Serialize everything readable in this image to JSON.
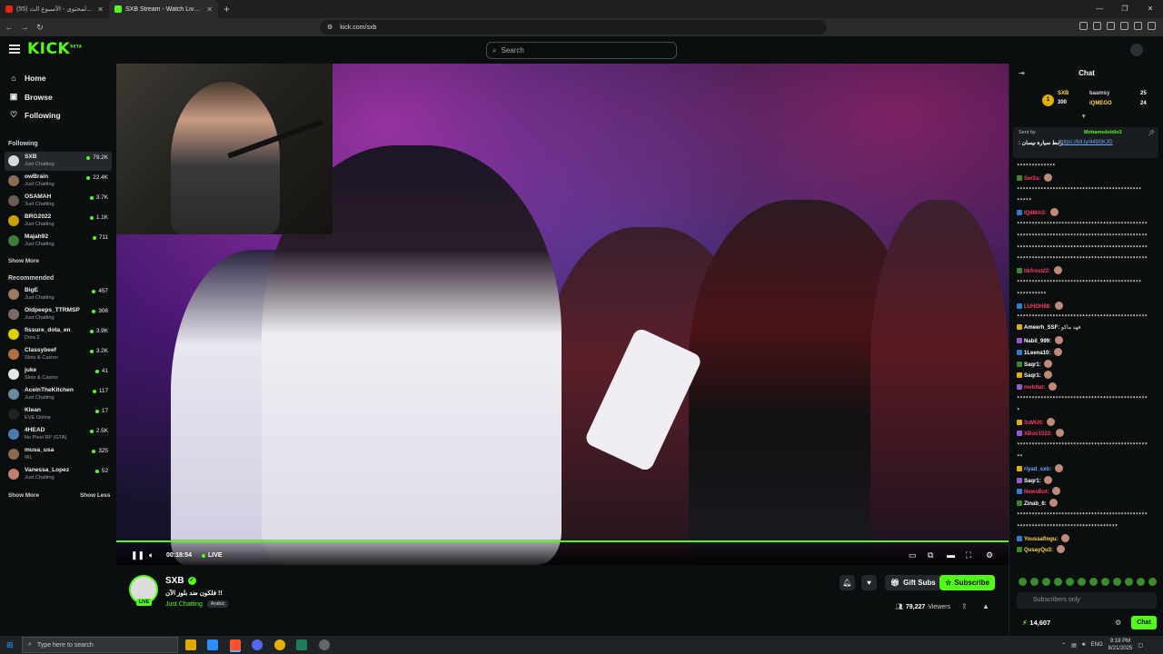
{
  "browser": {
    "tabs": [
      {
        "title": "(55) دوري صناع المحتوى - الأسبوع الث...",
        "favicon_color": "#e62117",
        "active": false
      },
      {
        "title": "SXB Stream - Watch Live on Kick",
        "favicon_color": "#53fc18",
        "active": true
      }
    ],
    "url": "kick.com/sxb"
  },
  "header": {
    "logo": "KICK",
    "logo_sup": "BETA",
    "search_placeholder": "Search"
  },
  "sidebar": {
    "nav": [
      {
        "label": "Home",
        "icon": "home-icon"
      },
      {
        "label": "Browse",
        "icon": "browse-icon"
      },
      {
        "label": "Following",
        "icon": "heart-icon"
      }
    ],
    "following_title": "Following",
    "following": [
      {
        "name": "SXB",
        "category": "Just Chatting",
        "viewers": "79.2K",
        "avatar_color": "#d8d8d8"
      },
      {
        "name": "owBrain",
        "category": "Just Chatting",
        "viewers": "22.4K",
        "avatar_color": "#8a6b55"
      },
      {
        "name": "OSAMAH",
        "category": "Just Chatting",
        "viewers": "3.7K",
        "avatar_color": "#6a5a52"
      },
      {
        "name": "BRG2022",
        "category": "Just Chatting",
        "viewers": "1.1K",
        "avatar_color": "#c9a000"
      },
      {
        "name": "Majah92",
        "category": "Just Chatting",
        "viewers": "711",
        "avatar_color": "#3e7a3a"
      }
    ],
    "show_more": "Show More",
    "recommended_title": "Recommended",
    "recommended": [
      {
        "name": "BigE",
        "category": "Just Chatting",
        "viewers": "457",
        "avatar_color": "#9a7a5a"
      },
      {
        "name": "Oldpeeps_TTRMSP",
        "category": "Just Chatting",
        "viewers": "306",
        "avatar_color": "#7a6a6a"
      },
      {
        "name": "fissure_dota_en",
        "category": "Dota 2",
        "viewers": "3.9K",
        "avatar_color": "#e0d000"
      },
      {
        "name": "Classybeef",
        "category": "Slots & Casino",
        "viewers": "3.2K",
        "avatar_color": "#b07040"
      },
      {
        "name": "juke",
        "category": "Slots & Casino",
        "viewers": "41",
        "avatar_color": "#e8e8e8"
      },
      {
        "name": "AceInTheKitchen",
        "category": "Just Chatting",
        "viewers": "117",
        "avatar_color": "#6a8aa0"
      },
      {
        "name": "Klean",
        "category": "EVE Online",
        "viewers": "17",
        "avatar_color": "#222222"
      },
      {
        "name": "4HEAD",
        "category": "No Pixel RP (GTA)",
        "viewers": "2.5K",
        "avatar_color": "#4a7ab0"
      },
      {
        "name": "musa_usa",
        "category": "IRL",
        "viewers": "325",
        "avatar_color": "#8a6a4a"
      },
      {
        "name": "Vanessa_Lopez",
        "category": "Just Chatting",
        "viewers": "52",
        "avatar_color": "#c08070"
      }
    ],
    "show_less": "Show Less"
  },
  "player": {
    "time": "00:18:54",
    "live_label": "LIVE",
    "progress": 1.0
  },
  "channel": {
    "name": "SXB",
    "title": "!! فلكون ضد بلوز الآن",
    "category": "Just Chatting",
    "tag": "Arabic",
    "live_badge": "LIVE",
    "gift_label": "Gift Subs",
    "subscribe_label": "Subscribe",
    "viewers_count": "79,227",
    "viewers_label": "Viewers"
  },
  "chat": {
    "title": "Chat",
    "leaderboard": {
      "top_name": "SXB",
      "top_count": "300",
      "second_name": "baamsy",
      "second_count": "25",
      "third_name": "iQMEGO",
      "third_count": "24"
    },
    "pinned": {
      "sent_by": "Sent by",
      "author": "Mohamedeldin3",
      "text": "رابط سيارة نيسان :",
      "link": "https://bit.ly/449SKJG"
    },
    "messages": [
      {
        "user": "",
        "color": "#ffffff",
        "text": "٭٭٭٭٭٭٭٭٭٭٭٭٭"
      },
      {
        "user": "Ser2a:",
        "color": "#ff3b5c",
        "text": ""
      },
      {
        "user": "",
        "color": "#ffffff",
        "text": "٭٭٭٭٭٭٭٭٭٭٭٭٭٭٭٭٭٭٭٭٭٭٭٭٭٭٭٭٭٭٭٭٭٭٭٭٭٭٭٭٭٭"
      },
      {
        "user": "",
        "color": "#ffffff",
        "text": "٭٭٭٭٭"
      },
      {
        "user": "IQ8MAS:",
        "color": "#ff3b5c",
        "text": ""
      },
      {
        "user": "",
        "color": "#ffffff",
        "text": "٭٭٭٭٭٭٭٭٭٭٭٭٭٭٭٭٭٭٭٭٭٭٭٭٭٭٭٭٭٭٭٭٭٭٭٭٭٭٭٭٭٭٭٭"
      },
      {
        "user": "",
        "color": "#ffffff",
        "text": "٭٭٭٭٭٭٭٭٭٭٭٭٭٭٭٭٭٭٭٭٭٭٭٭٭٭٭٭٭٭٭٭٭٭٭٭٭٭٭٭٭٭٭٭"
      },
      {
        "user": "",
        "color": "#ffffff",
        "text": "٭٭٭٭٭٭٭٭٭٭٭٭٭٭٭٭٭٭٭٭٭٭٭٭٭٭٭٭٭٭٭٭٭٭٭٭٭٭٭٭٭٭٭٭"
      },
      {
        "user": "",
        "color": "#ffffff",
        "text": "٭٭٭٭٭٭٭٭٭٭٭٭٭٭٭٭٭٭٭٭٭٭٭٭٭٭٭٭٭٭٭٭٭٭٭٭٭٭٭٭٭٭٭٭"
      },
      {
        "user": "bkfrost22:",
        "color": "#ff3b5c",
        "text": ""
      },
      {
        "user": "",
        "color": "#ffffff",
        "text": "٭٭٭٭٭٭٭٭٭٭٭٭٭٭٭٭٭٭٭٭٭٭٭٭٭٭٭٭٭٭٭٭٭٭٭٭٭٭٭٭٭٭"
      },
      {
        "user": "",
        "color": "#ffffff",
        "text": "٭٭٭٭٭٭٭٭٭٭"
      },
      {
        "user": "LUHOH88:",
        "color": "#ff3b5c",
        "text": ""
      },
      {
        "user": "",
        "color": "#ffffff",
        "text": "٭٭٭٭٭٭٭٭٭٭٭٭٭٭٭٭٭٭٭٭٭٭٭٭٭٭٭٭٭٭٭٭٭٭٭٭٭٭٭٭٭٭٭٭"
      },
      {
        "user": "Ameerh_SSF:",
        "color": "#ffffff",
        "text": "فهد ماكو"
      },
      {
        "user": "Nabil_999:",
        "color": "#ffffff",
        "text": ""
      },
      {
        "user": "1Leena10:",
        "color": "#ffffff",
        "text": ""
      },
      {
        "user": "Saqr1:",
        "color": "#ffffff",
        "text": ""
      },
      {
        "user": "Saqr1:",
        "color": "#ffffff",
        "text": ""
      },
      {
        "user": "mehtlat:",
        "color": "#ff3b5c",
        "text": ""
      },
      {
        "user": "",
        "color": "#ffffff",
        "text": "٭٭٭٭٭٭٭٭٭٭٭٭٭٭٭٭٭٭٭٭٭٭٭٭٭٭٭٭٭٭٭٭٭٭٭٭٭٭٭٭٭٭٭٭"
      },
      {
        "user": "",
        "color": "#ffffff",
        "text": "٭"
      },
      {
        "user": "3nMU0:",
        "color": "#ff3b5c",
        "text": ""
      },
      {
        "user": "XBoo1533:",
        "color": "#ff3b5c",
        "text": ""
      },
      {
        "user": "",
        "color": "#ffffff",
        "text": "٭٭٭٭٭٭٭٭٭٭٭٭٭٭٭٭٭٭٭٭٭٭٭٭٭٭٭٭٭٭٭٭٭٭٭٭٭٭٭٭٭٭٭٭"
      },
      {
        "user": "",
        "color": "#ffffff",
        "text": "٭٭"
      },
      {
        "user": "riyad_sxb:",
        "color": "#6fa8ff",
        "text": ""
      },
      {
        "user": "Saqr1:",
        "color": "#ffffff",
        "text": ""
      },
      {
        "user": "NewsBot:",
        "color": "#ff3b5c",
        "text": ""
      },
      {
        "user": "Zinab_6:",
        "color": "#ffffff",
        "text": ""
      },
      {
        "user": "",
        "color": "#ffffff",
        "text": "٭٭٭٭٭٭٭٭٭٭٭٭٭٭٭٭٭٭٭٭٭٭٭٭٭٭٭٭٭٭٭٭٭٭٭٭٭٭٭٭٭٭٭٭"
      },
      {
        "user": "",
        "color": "#ffffff",
        "text": "٭٭٭٭٭٭٭٭٭٭٭٭٭٭٭٭٭٭٭٭٭٭٭٭٭٭٭٭٭٭٭٭٭٭"
      },
      {
        "user": "Youssafingu:",
        "color": "#ffd54a",
        "text": ""
      },
      {
        "user": "QusayQu3:",
        "color": "#ffd54a",
        "text": ""
      }
    ],
    "input_placeholder": "Subscribers only",
    "kicks": "14,607",
    "chat_button": "Chat"
  },
  "taskbar": {
    "search_placeholder": "Type here to search",
    "language": "ENG",
    "time": "9:18 PM",
    "date": "8/21/2025"
  }
}
